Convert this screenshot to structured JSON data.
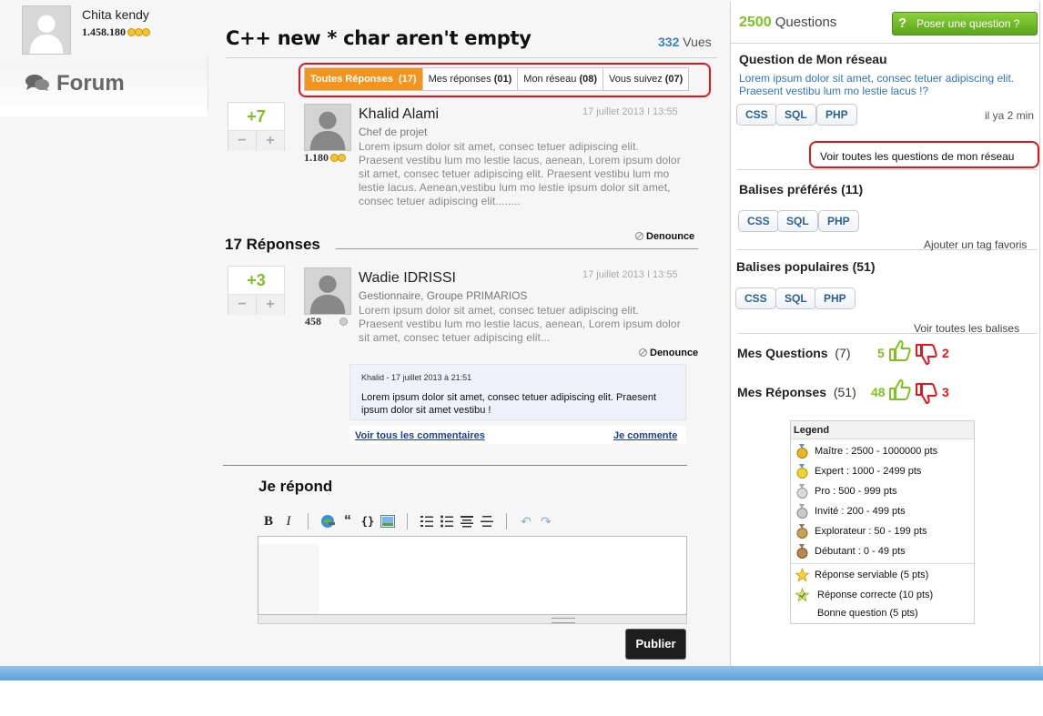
{
  "profile": {
    "name": "Chita kendy",
    "points": "1.458.180"
  },
  "nav": {
    "forum": "Forum"
  },
  "question": {
    "title": "C++ new * char aren't empty",
    "views_count": "332",
    "views_label": "Vues"
  },
  "tabs": [
    {
      "label": "Toutes Réponses",
      "count": "(17)"
    },
    {
      "label": "Mes réponses",
      "count": "(01)"
    },
    {
      "label": "Mon réseau",
      "count": "(08)"
    },
    {
      "label": "Vous suivez",
      "count": "(07)"
    }
  ],
  "post": {
    "score": "+7",
    "minus": "−",
    "plus": "+",
    "author": "Khalid Alami",
    "role": "Chef de projet",
    "points": "1.180",
    "date": "17 juillet 2013 I 13:55",
    "body": "Lorem ipsum dolor sit amet, consec tetuer adipiscing elit. Praesent vestibu lum mo lestie lacus, aenean, Lorem ipsum dolor sit amet, consec tetuer adipiscing elit. Praesent vestibu lum mo lestie lacus. Aenean,vestibu lum mo lestie ipsum dolor sit amet, consec tetuer adipiscing elit........"
  },
  "responses": {
    "title": "17 Réponses",
    "denonce": "Denounce"
  },
  "answer": {
    "score": "+3",
    "minus": "−",
    "plus": "+",
    "author": "Wadie IDRISSI",
    "role": "Gestionnaire, Groupe PRIMARIOS",
    "points": "458",
    "date": "17 juillet 2013 I 13:55",
    "body": "Lorem ipsum dolor sit amet, consec tetuer adipiscing elit. Praesent vestibu lum mo lestie lacus, aenean, Lorem ipsum dolor sit amet, consec tetuer adipiscing elit...",
    "denonce": "Denounce"
  },
  "comment": {
    "meta": "Khalid - 17 juillet 2013 à 21:51",
    "text": "Lorem ipsum dolor sit amet, consec tetuer adipiscing elit. Praesent ipsum dolor sit amet vestibu !",
    "see_all": "Voir tous les commentaires",
    "reply": "Je commente"
  },
  "reply": {
    "title": "Je répond",
    "publish": "Publier"
  },
  "sidebar": {
    "questions_count": "2500",
    "questions_label": "Questions",
    "ask": "Poser une question ?",
    "network_title": "Question de Mon réseau",
    "network_question": "Lorem ipsum dolor sit amet, consec tetuer adipiscing elit. Praesent vestibu lum mo lestie lacus !?",
    "network_tags": [
      "CSS",
      "SQL",
      "PHP"
    ],
    "ago": "il ya 2 min",
    "see_network": "Voir toutes les questions de mon réseau",
    "fav_title": "Balises préférés",
    "fav_count": "(11)",
    "fav_tags": [
      "CSS",
      "SQL",
      "PHP"
    ],
    "add_fav": "Ajouter un tag favoris",
    "pop_title": "Balises populaires",
    "pop_count": "(51)",
    "pop_tags": [
      "CSS",
      "SQL",
      "PHP"
    ],
    "see_tags": "Voir toutes les balises",
    "my_questions": {
      "label": "Mes Questions",
      "count": "(7)",
      "up": "5",
      "down": "2"
    },
    "my_answers": {
      "label": "Mes Réponses",
      "count": "(51)",
      "up": "48",
      "down": "3"
    }
  },
  "legend": {
    "title": "Legend",
    "rows": [
      {
        "icon": "medal-gold-icon",
        "text": "Maître : 2500 - 1000000 pts"
      },
      {
        "icon": "medal-yellow-icon",
        "text": "Expert : 1000 - 2499 pts"
      },
      {
        "icon": "medal-silver-icon",
        "text": "Pro : 500 - 999 pts"
      },
      {
        "icon": "medal-gray-icon",
        "text": "Invité : 200 - 499 pts"
      },
      {
        "icon": "medal-bronze-icon",
        "text": "Explorateur : 50 - 199 pts"
      },
      {
        "icon": "medal-brown-icon",
        "text": "Débutant : 0 - 49 pts"
      },
      {
        "icon": "star-icon",
        "text": "Réponse serviable (5 pts)"
      },
      {
        "icon": "star-check-icon",
        "text": "Réponse correcte (10 pts)"
      },
      {
        "icon": "",
        "text": "Bonne question (5 pts)"
      }
    ]
  },
  "colors": {
    "accent_green": "#7cc41b",
    "accent_orange": "#f5941d",
    "red": "#e8141a",
    "link_blue": "#2f76c2"
  }
}
